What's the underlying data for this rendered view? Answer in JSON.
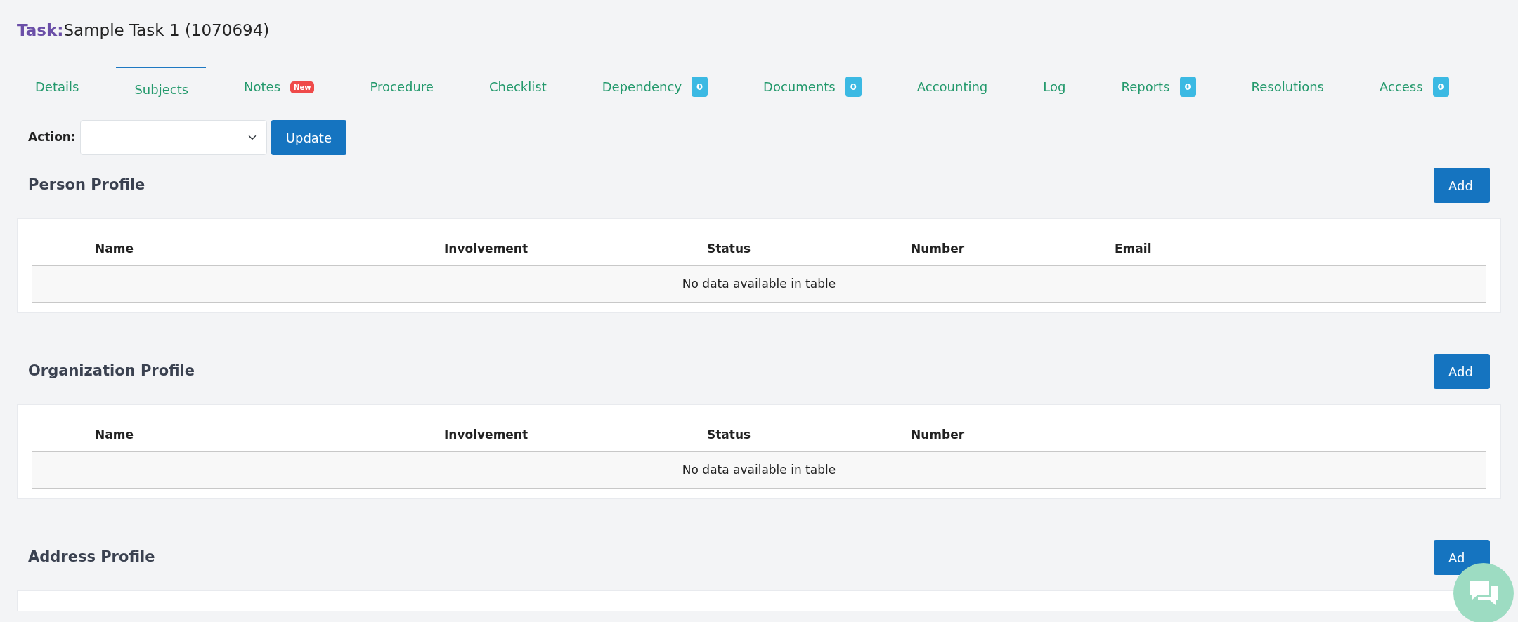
{
  "header": {
    "label": "Task:",
    "text": "Sample Task 1 (1070694)"
  },
  "tabs": [
    {
      "label": "Details",
      "selected": false
    },
    {
      "label": "Subjects",
      "selected": true
    },
    {
      "label": "Notes",
      "selected": false,
      "badge": {
        "kind": "new",
        "text": "New"
      }
    },
    {
      "label": "Procedure",
      "selected": false
    },
    {
      "label": "Checklist",
      "selected": false
    },
    {
      "label": "Dependency",
      "selected": false,
      "badge": {
        "kind": "count",
        "text": "0"
      }
    },
    {
      "label": "Documents",
      "selected": false,
      "badge": {
        "kind": "count",
        "text": "0"
      }
    },
    {
      "label": "Accounting",
      "selected": false
    },
    {
      "label": "Log",
      "selected": false
    },
    {
      "label": "Reports",
      "selected": false,
      "badge": {
        "kind": "count",
        "text": "0"
      }
    },
    {
      "label": "Resolutions",
      "selected": false
    },
    {
      "label": "Access",
      "selected": false,
      "badge": {
        "kind": "count",
        "text": "0"
      }
    }
  ],
  "action": {
    "label": "Action:",
    "button": "Update"
  },
  "sections": [
    {
      "title": "Person Profile",
      "add_button": "Add",
      "columns": [
        "Name",
        "Involvement",
        "Status",
        "Number",
        "Email"
      ],
      "empty_text": "No data available in table"
    },
    {
      "title": "Organization Profile",
      "add_button": "Add",
      "columns": [
        "Name",
        "Involvement",
        "Status",
        "Number"
      ],
      "empty_text": "No data available in table"
    },
    {
      "title": "Address Profile",
      "add_button": "Ad"
    }
  ]
}
